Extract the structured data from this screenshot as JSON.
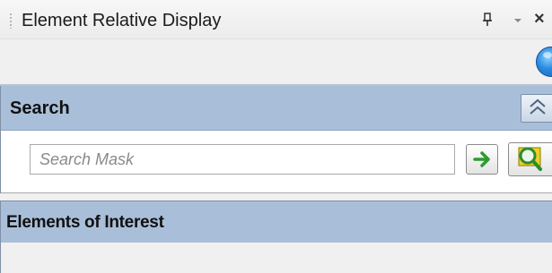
{
  "window": {
    "title": "Element Relative Display",
    "close_glyph": "×"
  },
  "search_panel": {
    "header_title": "Search",
    "search_input": {
      "value": "",
      "placeholder": "Search Mask"
    },
    "collapse_glyph": "︽"
  },
  "interest_panel": {
    "header_title": "Elements of Interest"
  },
  "icons": {
    "pin": "pin-icon",
    "dropdown": "chevron-down-icon",
    "close": "close-icon",
    "help": "help-icon",
    "collapse": "double-chevron-up-icon",
    "go": "arrow-right-icon",
    "find": "magnifier-icon"
  },
  "colors": {
    "panel_header_bg": "#a9bfd9",
    "go_arrow": "#2e9b2e",
    "find_icon_yellow": "#f0d020"
  }
}
